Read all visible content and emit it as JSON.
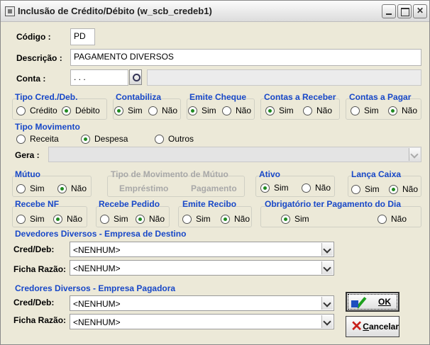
{
  "window": {
    "title": "Inclusão de Crédito/Débito (w_scb_credeb1)"
  },
  "codigo": {
    "label": "Código :",
    "value": "PD"
  },
  "descricao": {
    "label": "Descrição :",
    "value": "PAGAMENTO DIVERSOS"
  },
  "conta": {
    "label": "Conta :",
    "value": " .  .  ."
  },
  "tipo_cred_deb": {
    "label": "Tipo Cred./Deb.",
    "options": [
      "Crédito",
      "Débito"
    ],
    "selected": "Débito"
  },
  "contabiliza": {
    "label": "Contabiliza",
    "options": [
      "Sim",
      "Não"
    ],
    "selected": "Sim"
  },
  "emite_cheque": {
    "label": "Emite Cheque",
    "options": [
      "Sim",
      "Não"
    ],
    "selected": "Sim"
  },
  "contas_receber": {
    "label": "Contas a Receber",
    "options": [
      "Sim",
      "Não"
    ],
    "selected": "Sim"
  },
  "contas_pagar": {
    "label": "Contas a Pagar",
    "options": [
      "Sim",
      "Não"
    ],
    "selected": "Não"
  },
  "tipo_movimento": {
    "label": "Tipo Movimento",
    "options": [
      "Receita",
      "Despesa",
      "Outros"
    ],
    "selected": "Despesa"
  },
  "gera": {
    "label": "Gera :",
    "value": ""
  },
  "mutuo": {
    "label": "Mútuo",
    "options": [
      "Sim",
      "Não"
    ],
    "selected": "Não"
  },
  "tipo_mov_mutuo": {
    "label": "Tipo de Movimento de Mútuo",
    "options": [
      "Empréstimo",
      "Pagamento"
    ]
  },
  "ativo": {
    "label": "Ativo",
    "options": [
      "Sim",
      "Não"
    ],
    "selected": "Sim"
  },
  "lanca_caixa": {
    "label": "Lança Caixa",
    "options": [
      "Sim",
      "Não"
    ],
    "selected": "Não"
  },
  "recebe_nf": {
    "label": "Recebe NF",
    "options": [
      "Sim",
      "Não"
    ],
    "selected": "Não"
  },
  "recebe_pedido": {
    "label": "Recebe Pedido",
    "options": [
      "Sim",
      "Não"
    ],
    "selected": "Não"
  },
  "emite_recibo": {
    "label": "Emite Recibo",
    "options": [
      "Sim",
      "Não"
    ],
    "selected": "Não"
  },
  "obrigatorio_pagamento": {
    "label": "Obrigatório ter Pagamento do Dia",
    "options": [
      "Sim",
      "Não"
    ],
    "selected": "Sim"
  },
  "devedores": {
    "label": "Devedores Diversos - Empresa de Destino",
    "cred_deb_label": "Cred/Deb:",
    "cred_deb_value": "<NENHUM>",
    "ficha_label": "Ficha Razão:",
    "ficha_value": "<NENHUM>"
  },
  "credores": {
    "label": "Credores Diversos - Empresa Pagadora",
    "cred_deb_label": "Cred/Deb:",
    "cred_deb_value": "<NENHUM>",
    "ficha_label": "Ficha Razão:",
    "ficha_value": "<NENHUM>"
  },
  "buttons": {
    "ok": "OK",
    "cancel_first": "C",
    "cancel_rest": "ancelar"
  },
  "colors": {
    "section_label": "#1848c8",
    "radio_selected": "#1f8a1f",
    "window_bg": "#ece9d8"
  }
}
